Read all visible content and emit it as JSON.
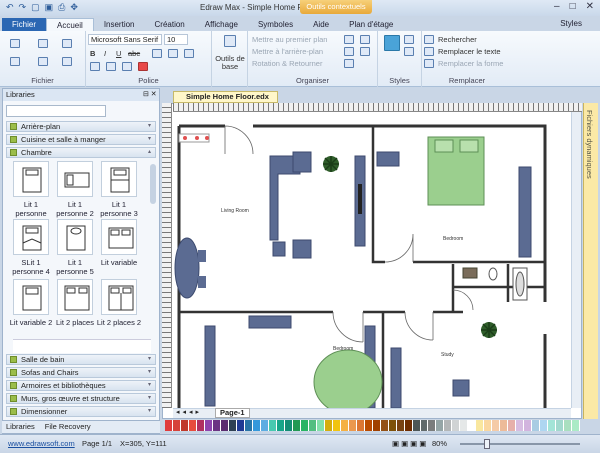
{
  "app": {
    "title": "Edraw Max - Simple Home Floor.edx",
    "context_tab": "Outils contextuels",
    "styles_label": "Styles"
  },
  "ribbon_tabs": [
    "Fichier",
    "Accueil",
    "Insertion",
    "Création",
    "Affichage",
    "Symboles",
    "Aide",
    "Plan d'étage"
  ],
  "ribbon": {
    "font_name": "Microsoft Sans Serif",
    "font_size": "10",
    "fichier_label": "Fichier",
    "police_label": "Police",
    "outils_label": "Outils de base",
    "organiser_label": "Organiser",
    "styles_label": "Styles",
    "remplacer_label": "Remplacer",
    "mettre_premier": "Mettre au premier plan",
    "mettre_arriere": "Mettre à l'arrière-plan",
    "rotation": "Rotation & Retourner",
    "rechercher": "Rechercher",
    "remplacer_texte": "Remplacer le texte",
    "remplacer_forme": "Remplacer la forme",
    "bold": "B",
    "italic": "I",
    "underline": "U",
    "strike": "abc"
  },
  "libraries": {
    "header": "Libraries",
    "categories_top": [
      "Arrière-plan",
      "Cuisine et salle à manger",
      "Chambre"
    ],
    "shapes": [
      [
        "Lit 1",
        "personne"
      ],
      [
        "Lit 1",
        "personne 2"
      ],
      [
        "Lit 1",
        "personne 3"
      ],
      [
        "SLit 1",
        "personne 4"
      ],
      [
        "Lit 1",
        "personne 5"
      ],
      [
        "Lit variable",
        ""
      ],
      [
        "Lit variable 2",
        ""
      ],
      [
        "Lit 2 places",
        ""
      ],
      [
        "Lit 2 places 2",
        ""
      ]
    ],
    "categories_bottom": [
      "Salle de bain",
      "Sofas and Chairs",
      "Armoires et bibliothèques",
      "Murs, gros œuvre et structure",
      "Dimensionner"
    ],
    "tabs": [
      "Libraries",
      "File Recovery"
    ]
  },
  "document": {
    "tab": "Simple Home Floor.edx",
    "page_tab": "Page-1",
    "right_panel": "Fichiers dynamiques",
    "rooms": [
      "Living Room",
      "Bedroom",
      "Bedroom",
      "Study"
    ]
  },
  "palette": [
    "#e03b3b",
    "#d6423a",
    "#c0392b",
    "#e74c3c",
    "#b03060",
    "#8e44ad",
    "#6c3483",
    "#5b2c6f",
    "#2e4053",
    "#1f3a93",
    "#2874a6",
    "#3498db",
    "#5dade2",
    "#48c9b0",
    "#17a589",
    "#138d75",
    "#229954",
    "#28b463",
    "#52be80",
    "#82e0aa",
    "#d4ac0d",
    "#f1c40f",
    "#f5b041",
    "#eb984e",
    "#dc7633",
    "#ba4a00",
    "#a04000",
    "#935116",
    "#7e5109",
    "#784212",
    "#6e2c00",
    "#4d5656",
    "#616a6b",
    "#7b7d7d",
    "#95a5a6",
    "#b3b6b7",
    "#d0d3d4",
    "#e5e8e8",
    "#ffffff",
    "#f9e79f",
    "#fad7a0",
    "#f5cba7",
    "#edbb99",
    "#e6b0aa",
    "#d7bde2",
    "#d2b4de",
    "#a9cce3",
    "#aed6f1",
    "#a3e4d7",
    "#a2d9ce",
    "#a9dfbf",
    "#abebc6"
  ],
  "status": {
    "website": "www.edrawsoft.com",
    "page": "Page 1/1",
    "coords": "X=305, Y=111",
    "zoom": "80%"
  }
}
